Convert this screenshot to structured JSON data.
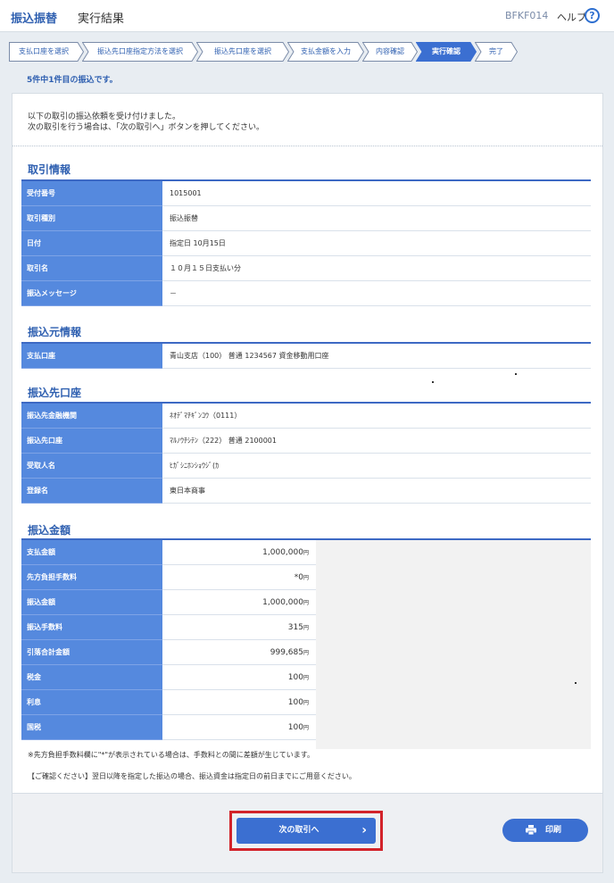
{
  "header": {
    "title": "振込振替",
    "subtitle": "実行結果",
    "screen_code": "BFKF014",
    "help": "ヘルプ",
    "help_icon": "?"
  },
  "steps": [
    "支払口座を選択",
    "振込先口座指定方法を選択",
    "振込先口座を選択",
    "支払金額を入力",
    "内容確認",
    "実行確認",
    "完了"
  ],
  "progress": "5件中1件目の振込です。",
  "intro": {
    "line1": "以下の取引の振込依頼を受け付けました。",
    "line2": "次の取引を行う場合は、「次の取引へ」ボタンを押してください。"
  },
  "transaction": {
    "heading": "取引情報",
    "rows": [
      {
        "label": "受付番号",
        "value": "1015001"
      },
      {
        "label": "取引種別",
        "value": "振込振替"
      },
      {
        "label": "日付",
        "value": "指定日 10月15日"
      },
      {
        "label": "取引名",
        "value": "１０月１５日支払い分"
      },
      {
        "label": "振込メッセージ",
        "value": "－"
      }
    ]
  },
  "source": {
    "heading": "振込元情報",
    "rows": [
      {
        "label": "支払口座",
        "value": "青山支店（100） 普通 1234567 資金移動用口座"
      }
    ]
  },
  "destination": {
    "heading": "振込先口座",
    "rows": [
      {
        "label": "振込先金融機関",
        "value": "ﾈｵﾃﾞﾏﾁｷﾞﾝｺｳ（0111）"
      },
      {
        "label": "振込先口座",
        "value": "ﾏﾙﾉｳﾁｼﾃﾝ（222） 普通 2100001"
      },
      {
        "label": "受取人名",
        "value": "ﾋｶﾞｼﾆﾎﾝｼｮｳｼﾞ(ｶ"
      },
      {
        "label": "登録名",
        "value": "東日本商事"
      }
    ]
  },
  "amounts": {
    "heading": "振込金額",
    "yen": "円",
    "rows": [
      {
        "label": "支払金額",
        "value": "1,000,000"
      },
      {
        "label": "先方負担手数料",
        "value": "*0"
      },
      {
        "label": "振込金額",
        "value": "1,000,000"
      },
      {
        "label": "振込手数料",
        "value": "315"
      },
      {
        "label": "引落合計金額",
        "value": "999,685"
      },
      {
        "label": "税金",
        "value": "100"
      },
      {
        "label": "利息",
        "value": "100"
      },
      {
        "label": "国税",
        "value": "100"
      }
    ]
  },
  "notes": {
    "fee_note": "※先方負担手数料欄に\"*\"が表示されている場合は、手数料との間に差額が生じています。",
    "confirm_note": "【ご確認ください】翌日以降を指定した振込の場合、振込資金は指定日の前日までにご用意ください。"
  },
  "buttons": {
    "next": "次の取引へ",
    "next_chevron": "›",
    "print": "印刷"
  },
  "colors": {
    "accent": "#2e5fb0",
    "label_bg": "#5589de",
    "button": "#3b6fd1",
    "highlight": "#d2232a"
  }
}
